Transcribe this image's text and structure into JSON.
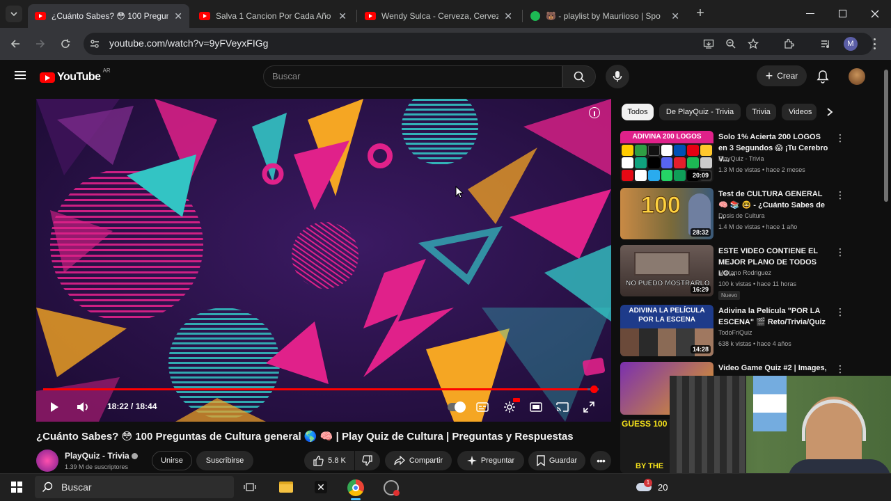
{
  "browser": {
    "tabs": [
      {
        "title": "¿Cuánto Sabes? 😳 100 Pregun",
        "active": true,
        "icon": "youtube-icon"
      },
      {
        "title": "Salva 1 Cancion Por Cada Año |",
        "active": false,
        "icon": "youtube-icon"
      },
      {
        "title": "Wendy Sulca - Cerveza, Cerveza",
        "active": false,
        "icon": "youtube-icon"
      },
      {
        "title": "🐻 - playlist by Mauriioso | Spo",
        "active": false,
        "icon": "spotify-icon"
      }
    ],
    "close_glyph": "✕",
    "new_tab_glyph": "+",
    "url": "youtube.com/watch?v=9yFVeyxFIGg",
    "profile_initial": "M"
  },
  "youtube": {
    "logo_text": "YouTube",
    "country": "AR",
    "search_placeholder": "Buscar",
    "create_label": "Crear"
  },
  "player": {
    "time": "18:22 / 18:44",
    "progress": 0.98
  },
  "video": {
    "title": "¿Cuánto Sabes? 😳 100 Preguntas de Cultura general 🌎 🧠 | Play Quiz de Cultura | Preguntas y Respuestas",
    "channel": "PlayQuiz - Trivia",
    "subscribers": "1.39 M de suscriptores",
    "join_label": "Unirse",
    "subscribe_label": "Suscribirse",
    "likes": "5.8 K",
    "share_label": "Compartir",
    "ask_label": "Preguntar",
    "save_label": "Guardar"
  },
  "chips": [
    "Todos",
    "De PlayQuiz - Trivia",
    "Trivia",
    "Videos"
  ],
  "recommendations": [
    {
      "title": "Solo 1% Acierta 200 LOGOS en 3 Segundos 😱 ¡Tu Cerebro V...",
      "channel": "PlayQuiz - Trivia",
      "meta": "1.3 M de vistas • hace 2 meses",
      "duration": "20:09",
      "thumb_text": "ADIVINA 200 LOGOS"
    },
    {
      "title": "Test de CULTURA GENERAL 🧠 📚 🤓 - ¿Cuánto Sabes de ...",
      "channel": "Dosis de Cultura",
      "meta": "1.4 M de vistas • hace 1 año",
      "duration": "28:32",
      "thumb_text": "100"
    },
    {
      "title": "ESTE VIDEO CONTIENE EL MEJOR PLANO DE TODOS LO...",
      "channel": "Mariano Rodriguez",
      "meta": "100 k vistas • hace 11 horas",
      "duration": "16:29",
      "badge": "Nuevo",
      "thumb_text": "NO PUEDO MOSTRARLO"
    },
    {
      "title": "Adivina la Película \"POR LA ESCENA\" 🎬 Reto/Trivia/Quiz",
      "channel": "TodoFriQuiz",
      "meta": "638 k vistas • hace 4 años",
      "duration": "14:28",
      "thumb_text": "ADIVINA LA PELÍCULA POR LA ESCENA"
    },
    {
      "title": "Video Game Quiz #2 | Images,",
      "channel": "",
      "meta": "",
      "duration": "",
      "thumb_text": ""
    }
  ],
  "extra_thumb_text": "GUESS 100",
  "extra_thumb_text_2": "BY THE",
  "taskbar": {
    "search_placeholder": "Buscar",
    "weather_partial": "20",
    "notification_count": "1"
  },
  "colors": {
    "youtube_red": "#ff0000",
    "background": "#0f0f0f",
    "player_bg": "#2b1245",
    "accent_pink": "#e0218a",
    "accent_yellow": "#f5a623",
    "accent_cyan": "#33c4c4"
  }
}
